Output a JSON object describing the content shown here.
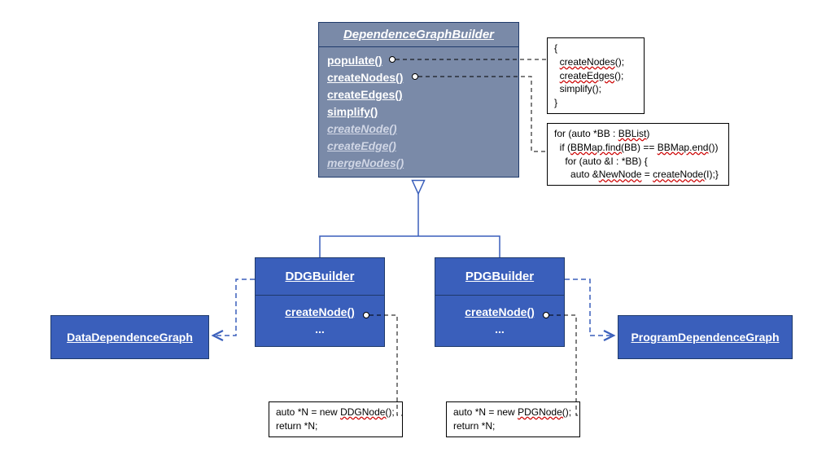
{
  "parent": {
    "title": "DependenceGraphBuilder",
    "methods": {
      "populate": "populate()",
      "createNodes": "createNodes()",
      "createEdges": "createEdges()",
      "simplify": "simplify()",
      "createNode": "createNode()",
      "createEdge": "createEdge()",
      "mergeNodes": "mergeNodes()"
    }
  },
  "note1": {
    "l1": "{",
    "l2a": "createNodes",
    "l2b": "();",
    "l3a": "createEdges",
    "l3b": "();",
    "l4": "simplify();",
    "l5": "}"
  },
  "note2": {
    "l1a": "for (auto *BB : ",
    "l1b": "BBList",
    "l1c": ")",
    "l2a": "if (",
    "l2b": "BBMap.find(",
    "l2c": "BB) == ",
    "l2d": "BBMap.end",
    "l2e": "())",
    "l3": "for (auto &I : *BB) {",
    "l4a": "auto &",
    "l4b": "NewNode",
    "l4c": " = ",
    "l4d": "createNode(",
    "l4e": "I);}"
  },
  "ddg": {
    "title": "DDGBuilder",
    "createNode": "createNode()",
    "ellipsis": "..."
  },
  "pdg": {
    "title": "PDGBuilder",
    "createNode": "createNode()",
    "ellipsis": "..."
  },
  "dataDepGraph": "DataDependenceGraph",
  "progDepGraph": "ProgramDependenceGraph",
  "ddgNote": {
    "l1a": "auto *N = new ",
    "l1b": "DDGNode(",
    "l1c": ");",
    "l2": "return *N;"
  },
  "pdgNote": {
    "l1a": "auto *N = new ",
    "l1b": "PDGNode(",
    "l1c": ");",
    "l2": "return *N;"
  }
}
